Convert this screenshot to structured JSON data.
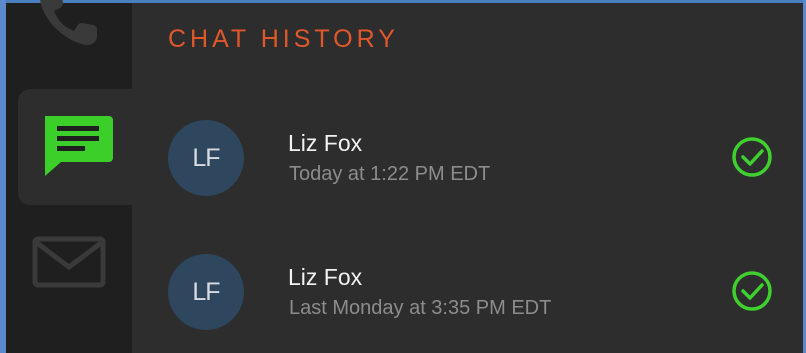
{
  "title": "CHAT HISTORY",
  "colors": {
    "accent_orange": "#e0582a",
    "chat_icon_green": "#3ccf2a",
    "check_green": "#3fcf2e",
    "avatar_bg": "#2e465e",
    "frame_blue": "#5a8acb"
  },
  "sidebar": {
    "items": [
      {
        "icon": "phone-icon",
        "active": false
      },
      {
        "icon": "chat-icon",
        "active": true
      },
      {
        "icon": "mail-icon",
        "active": false
      }
    ]
  },
  "chats": [
    {
      "initials": "LF",
      "name": "Liz Fox",
      "time": "Today at 1:22 PM EDT",
      "status_icon": "check-circle-icon"
    },
    {
      "initials": "LF",
      "name": "Liz Fox",
      "time": "Last Monday at 3:35 PM EDT",
      "status_icon": "check-circle-icon"
    }
  ]
}
